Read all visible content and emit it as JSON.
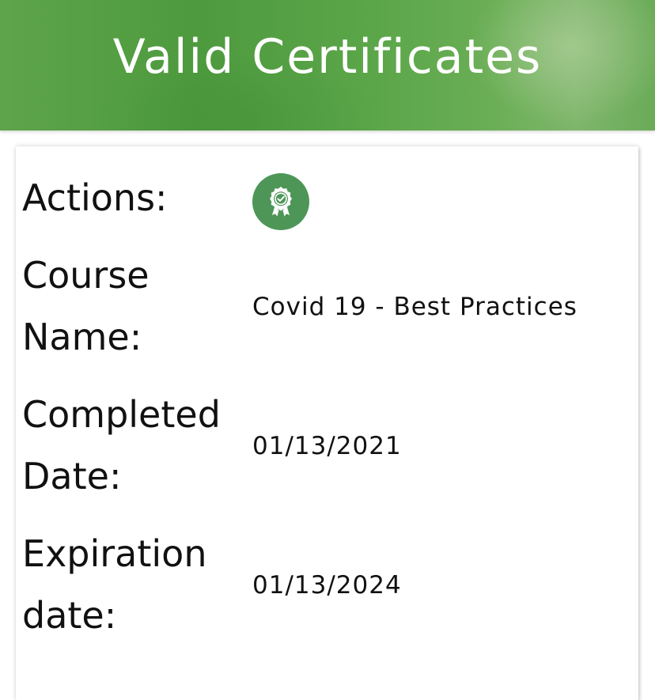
{
  "header": {
    "title": "Valid Certificates"
  },
  "certificate": {
    "actions_label": "Actions:",
    "actions_icon": "certificate-ribbon-icon",
    "course_label": "Course Name:",
    "course_value": "Covid 19 - Best Practices",
    "completed_label": "Completed Date:",
    "completed_value": "01/13/2021",
    "expiration_label": "Expiration date:",
    "expiration_value": "01/13/2024"
  },
  "colors": {
    "header_green": "#5aa548",
    "icon_button_green": "#4d9658",
    "text": "#111111"
  }
}
